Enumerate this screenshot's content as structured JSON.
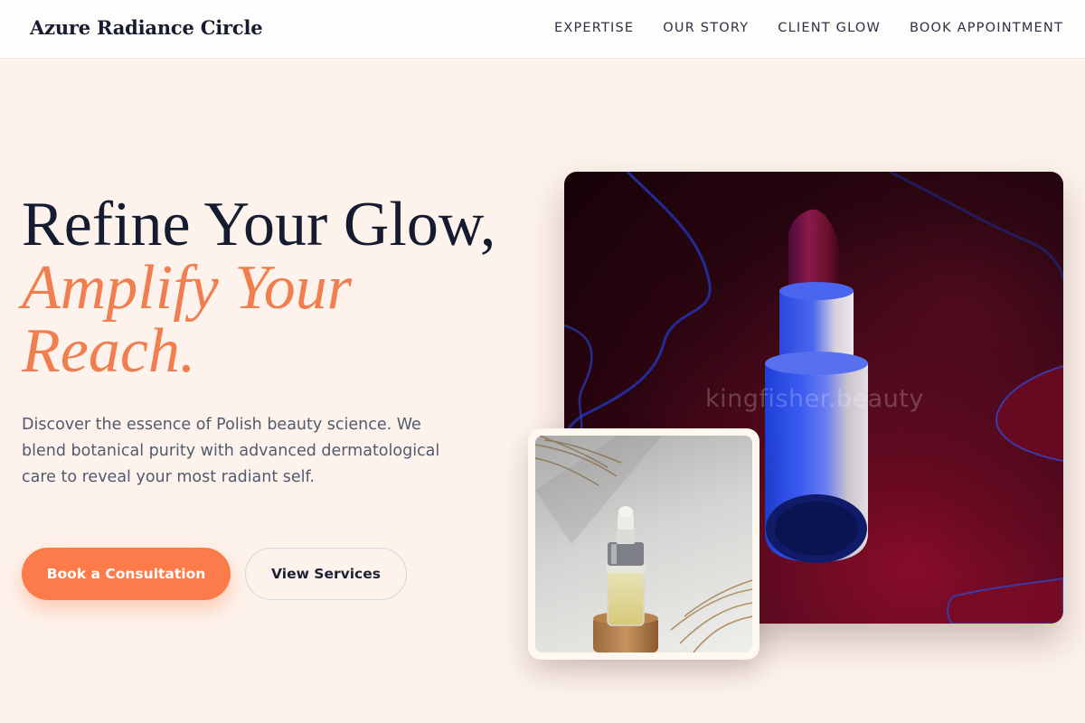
{
  "header": {
    "brand": "Azure Radiance Circle",
    "nav": [
      {
        "label": "EXPERTISE"
      },
      {
        "label": "OUR STORY"
      },
      {
        "label": "CLIENT GLOW"
      },
      {
        "label": "BOOK APPOINTMENT"
      }
    ]
  },
  "hero": {
    "title_line1": "Refine Your Glow,",
    "title_accent": "Amplify Your Reach.",
    "description": "Discover the essence of Polish beauty science. We blend botanical purity with advanced dermatological care to reveal your most radiant self.",
    "primary_button": "Book a Consultation",
    "secondary_button": "View Services"
  },
  "images": {
    "main_watermark": "kingfisher.beauty"
  },
  "colors": {
    "accent": "#fb7c4a",
    "heading": "#151c30",
    "background": "#fdf3ec"
  }
}
